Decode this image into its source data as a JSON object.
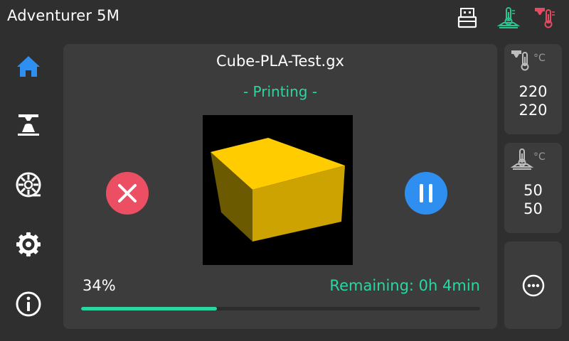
{
  "app": {
    "title": "Adventurer 5M"
  },
  "topbar": {
    "icons": [
      "usb-drive-icon",
      "bed-temperature-icon",
      "nozzle-temperature-icon"
    ],
    "colors": {
      "usb": "#ffffff",
      "bed": "#2bc28d",
      "nozzle": "#e34b62"
    }
  },
  "sidebar": {
    "items": [
      {
        "name": "home",
        "icon": "home-icon",
        "active": true,
        "color": "#2f8ff0"
      },
      {
        "name": "print",
        "icon": "printer-icon",
        "active": false
      },
      {
        "name": "filament",
        "icon": "filament-spool-icon",
        "active": false
      },
      {
        "name": "settings",
        "icon": "gear-icon",
        "active": false
      },
      {
        "name": "info",
        "icon": "info-icon",
        "active": false
      }
    ]
  },
  "job": {
    "file_name": "Cube-PLA-Test.gx",
    "status": "- Printing -",
    "progress_label": "34%",
    "progress_fraction": 0.34,
    "remaining": "Remaining: 0h 4min"
  },
  "controls": {
    "cancel_icon": "close-icon",
    "pause_icon": "pause-icon",
    "cancel_color": "#ec4e64",
    "pause_color": "#2f8ff0"
  },
  "temps": {
    "nozzle": {
      "unit": "°C",
      "current": "220",
      "target": "220",
      "icon": "nozzle-thermometer-icon"
    },
    "bed": {
      "unit": "°C",
      "current": "50",
      "target": "50",
      "icon": "bed-thermometer-icon"
    }
  },
  "more": {
    "icon": "more-options-icon"
  },
  "colors": {
    "accent": "#2bd6a3",
    "panel": "#3c3c3c",
    "background": "#2f2f2f"
  }
}
